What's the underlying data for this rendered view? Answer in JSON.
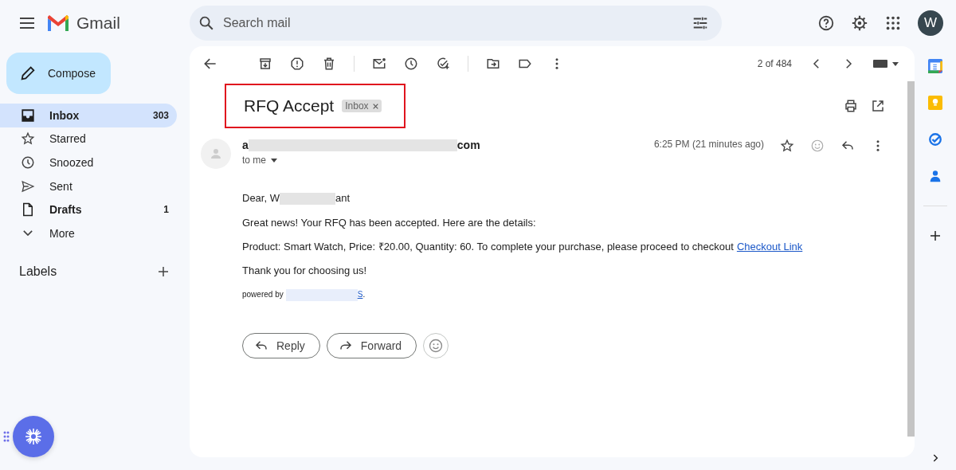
{
  "app": {
    "name": "Gmail"
  },
  "search": {
    "placeholder": "Search mail"
  },
  "account": {
    "initial": "W"
  },
  "compose": {
    "label": "Compose"
  },
  "nav": [
    {
      "kind": "inbox",
      "label": "Inbox",
      "count": "303",
      "selected": true,
      "unread": true
    },
    {
      "kind": "star",
      "label": "Starred",
      "selected": false,
      "unread": false
    },
    {
      "kind": "clock",
      "label": "Snoozed",
      "selected": false,
      "unread": false
    },
    {
      "kind": "sent",
      "label": "Sent",
      "selected": false,
      "unread": false
    },
    {
      "kind": "draft",
      "label": "Drafts",
      "count": "1",
      "selected": false,
      "unread": true
    },
    {
      "kind": "more",
      "label": "More",
      "selected": false,
      "unread": false
    }
  ],
  "labels": {
    "title": "Labels"
  },
  "toolbar": {
    "position": "2 of 484"
  },
  "message": {
    "subject": "RFQ Accept",
    "subject_highlighted": true,
    "label_chip": "Inbox",
    "sender_start": "a",
    "sender_end": "com",
    "recipient": "to me",
    "time": "6:25 PM (21 minutes ago)",
    "starred": false,
    "greeting_start": "Dear, W",
    "greeting_end": "ant",
    "intro": "Great news! Your RFQ has been accepted. Here are the details:",
    "details": "Product: Smart Watch, Price: ₹20.00, Quantity: 60. To complete your purchase, please proceed to checkout",
    "checkout_link": "Checkout Link",
    "thanks": "Thank you for choosing us!",
    "powered_by": "powered by",
    "powered_link_end": "S",
    "powered_end": "."
  },
  "actions": [
    {
      "kind": "reply",
      "label": "Reply"
    },
    {
      "kind": "forward",
      "label": "Forward"
    }
  ]
}
